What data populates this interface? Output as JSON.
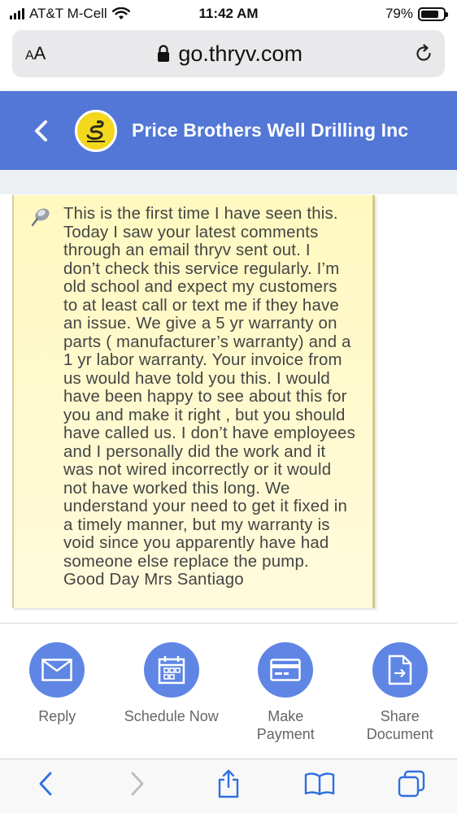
{
  "status_bar": {
    "carrier": "AT&T M-Cell",
    "time": "11:42 AM",
    "battery_percent": "79%",
    "battery_level": 0.79
  },
  "browser": {
    "aa_label": "AA",
    "url": "go.thryv.com"
  },
  "header": {
    "business_name": "Price Brothers Well Drilling Inc",
    "accent_color": "#5277d6"
  },
  "review_reply": {
    "text": "This is the first time I have seen this.\nToday I saw your latest comments\nthrough an email thryv sent out. I\ndon’t check this service regularly. I’m\nold school and expect my customers\nto at least call or text me if they have\nan issue. We give a 5 yr warranty on\nparts ( manufacturer’s warranty) and a\n1 yr labor warranty. Your invoice from\nus would have told you this. I would\nhave been happy to see about this for\nyou and make it right , but you should\nhave called us. I don’t have employees\nand I personally did the work and it\nwas not wired incorrectly or it would\nnot have worked this long. We\nunderstand your need to get it fixed in\na timely manner, but my warranty is\nvoid since you apparently have had\nsomeone else replace the pump.\nGood Day Mrs Santiago"
  },
  "actions": [
    {
      "label": "Reply",
      "icon": "envelope-icon"
    },
    {
      "label": "Schedule Now",
      "icon": "calendar-icon"
    },
    {
      "label": "Make\nPayment",
      "icon": "credit-card-icon"
    },
    {
      "label": "Share\nDocument",
      "icon": "document-share-icon"
    }
  ],
  "toolbar": {
    "icons": [
      "back-icon",
      "forward-icon",
      "share-icon",
      "bookmarks-icon",
      "tabs-icon"
    ]
  }
}
